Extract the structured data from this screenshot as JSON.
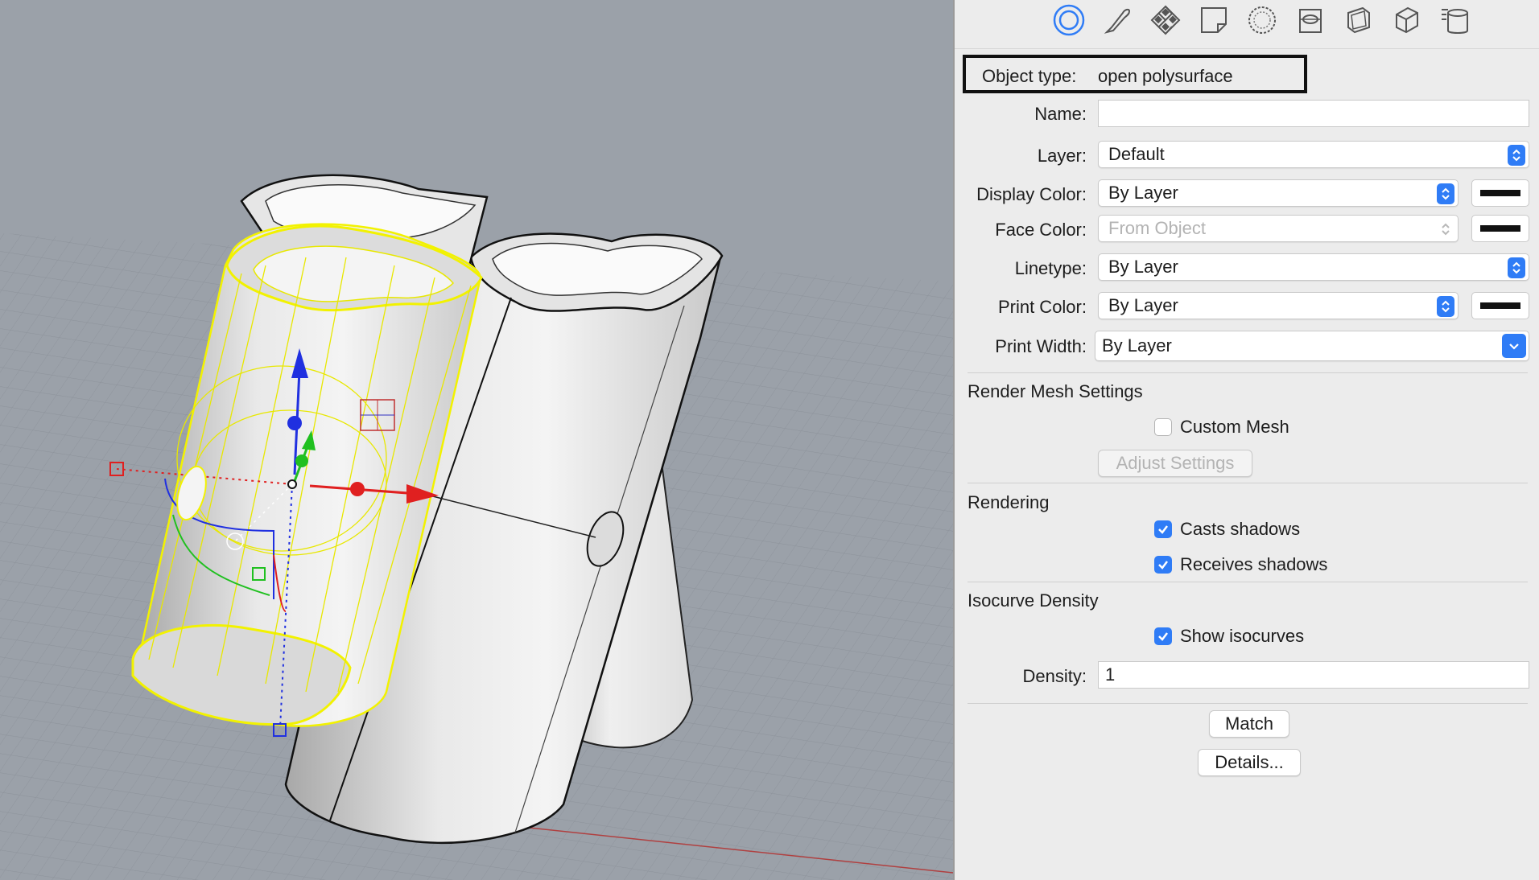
{
  "toolbar": {
    "icons": [
      "object-properties-icon",
      "curve-icon",
      "material-icon",
      "decal-icon",
      "displacement-icon",
      "section-icon",
      "shadow-icon",
      "box-edit-icon",
      "layers-icon"
    ]
  },
  "object_type": {
    "label": "Object type:",
    "value": "open polysurface"
  },
  "fields": {
    "name": {
      "label": "Name:",
      "value": ""
    },
    "layer": {
      "label": "Layer:",
      "value": "Default"
    },
    "display_color": {
      "label": "Display Color:",
      "value": "By Layer",
      "swatch": "#111111"
    },
    "face_color": {
      "label": "Face Color:",
      "value": "From Object",
      "swatch": "#111111"
    },
    "linetype": {
      "label": "Linetype:",
      "value": "By Layer"
    },
    "print_color": {
      "label": "Print Color:",
      "value": "By Layer",
      "swatch": "#111111"
    },
    "print_width": {
      "label": "Print Width:",
      "value": "By Layer"
    }
  },
  "render_mesh": {
    "title": "Render Mesh Settings",
    "custom_mesh": "Custom Mesh",
    "custom_mesh_checked": false,
    "adjust": "Adjust Settings"
  },
  "rendering": {
    "title": "Rendering",
    "casts": "Casts shadows",
    "casts_checked": true,
    "receives": "Receives shadows",
    "receives_checked": true
  },
  "isocurve": {
    "title": "Isocurve Density",
    "show": "Show isocurves",
    "show_checked": true,
    "density_label": "Density:",
    "density_value": "1"
  },
  "buttons": {
    "match": "Match",
    "details": "Details..."
  },
  "colors": {
    "accent": "#2f7cf6",
    "viewport_bg": "#9ba1a9",
    "selection": "#f2f200"
  }
}
